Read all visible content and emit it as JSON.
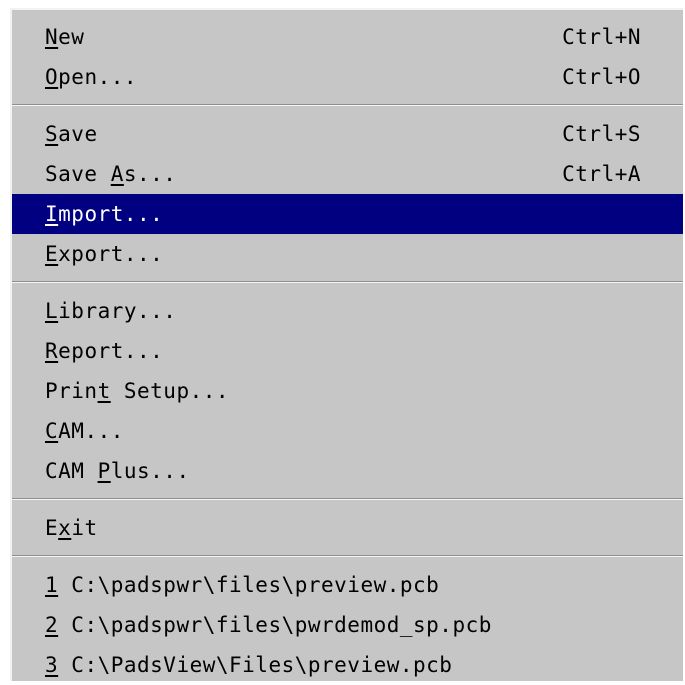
{
  "menu": {
    "group1": [
      {
        "pre": "",
        "u": "N",
        "post": "ew",
        "shortcut": "Ctrl+N"
      },
      {
        "pre": "",
        "u": "O",
        "post": "pen...",
        "shortcut": "Ctrl+O"
      }
    ],
    "group2": [
      {
        "pre": "",
        "u": "S",
        "post": "ave",
        "shortcut": "Ctrl+S"
      },
      {
        "pre": "Save ",
        "u": "A",
        "post": "s...",
        "shortcut": "Ctrl+A"
      },
      {
        "pre": "",
        "u": "I",
        "post": "mport...",
        "shortcut": "",
        "selected": true
      },
      {
        "pre": "",
        "u": "E",
        "post": "xport...",
        "shortcut": ""
      }
    ],
    "group3": [
      {
        "pre": "",
        "u": "L",
        "post": "ibrary..."
      },
      {
        "pre": "",
        "u": "R",
        "post": "eport..."
      },
      {
        "pre": "Prin",
        "u": "t",
        "post": " Setup..."
      },
      {
        "pre": "",
        "u": "C",
        "post": "AM..."
      },
      {
        "pre": "CAM ",
        "u": "P",
        "post": "lus..."
      }
    ],
    "group4": [
      {
        "pre": "E",
        "u": "x",
        "post": "it"
      }
    ],
    "recent": [
      {
        "u": "1",
        "post": " C:\\padspwr\\files\\preview.pcb"
      },
      {
        "u": "2",
        "post": " C:\\padspwr\\files\\pwrdemod_sp.pcb"
      },
      {
        "u": "3",
        "post": " C:\\PadsView\\Files\\preview.pcb"
      }
    ]
  },
  "colors": {
    "menu_bg": "#c6c6c6",
    "highlight": "#000080"
  }
}
